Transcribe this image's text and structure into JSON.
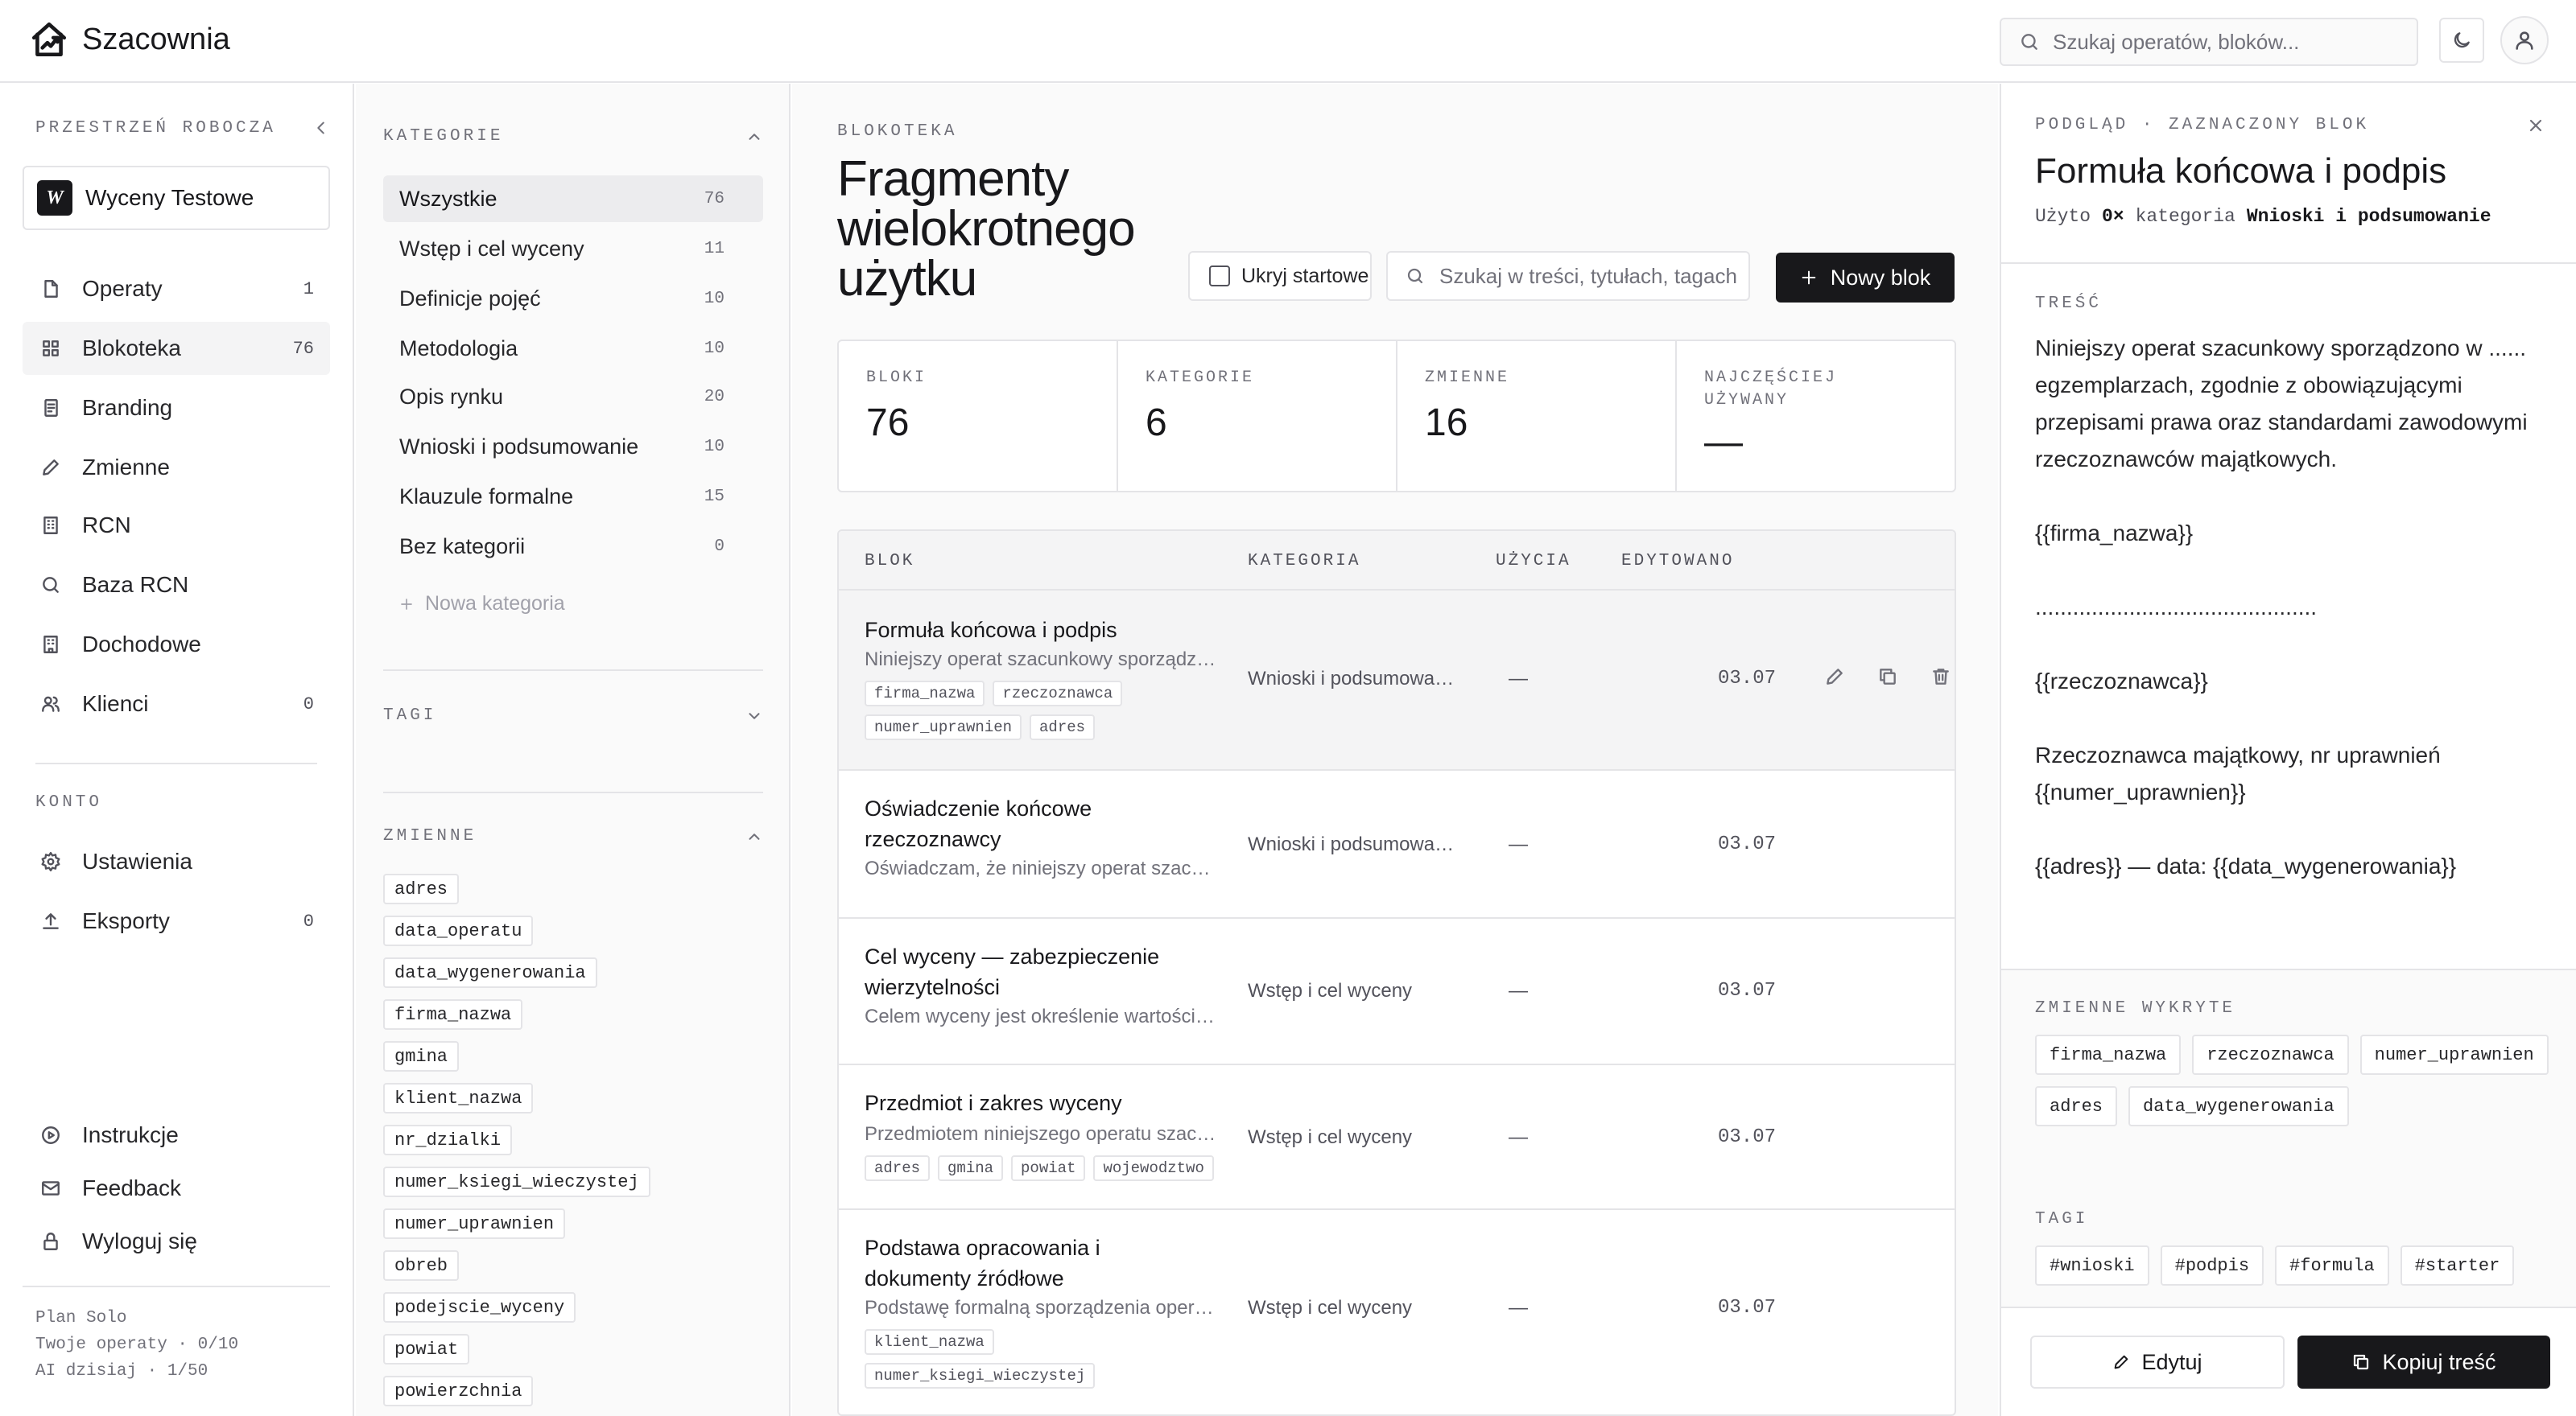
{
  "app": {
    "title": "Szacownia",
    "search_placeholder": "Szukaj operatów, bloków...",
    "icons": {
      "logo": "house-chart-logo",
      "theme": "moon-icon",
      "user": "user-icon"
    }
  },
  "sidebar": {
    "workspace_label": "PRZESTRZEŃ ROBOCZA",
    "workspace_badge": "W",
    "workspace_name": "Wyceny Testowe",
    "nav": [
      {
        "label": "Operaty",
        "count": "1",
        "icon": "file-icon"
      },
      {
        "label": "Blokoteka",
        "count": "76",
        "icon": "grid-icon",
        "active": true
      },
      {
        "label": "Branding",
        "count": "",
        "icon": "document-icon"
      },
      {
        "label": "Zmienne",
        "count": "",
        "icon": "pencil-icon"
      },
      {
        "label": "RCN",
        "count": "",
        "icon": "building-icon"
      },
      {
        "label": "Baza RCN",
        "count": "",
        "icon": "search-icon"
      },
      {
        "label": "Dochodowe",
        "count": "",
        "icon": "building-icon"
      },
      {
        "label": "Klienci",
        "count": "0",
        "icon": "users-icon"
      }
    ],
    "konto_label": "KONTO",
    "konto": [
      {
        "label": "Ustawienia",
        "count": "",
        "icon": "gear-icon"
      },
      {
        "label": "Eksporty",
        "count": "0",
        "icon": "upload-icon"
      }
    ],
    "bottom": [
      {
        "label": "Instrukcje",
        "icon": "play-circle-icon"
      },
      {
        "label": "Feedback",
        "icon": "message-icon"
      },
      {
        "label": "Wyloguj się",
        "icon": "lock-icon"
      }
    ],
    "plan": {
      "line1": "Plan Solo",
      "line2": "Twoje operaty · 0/10",
      "line3": "AI dzisiaj · 1/50"
    }
  },
  "categories": {
    "label": "KATEGORIE",
    "items": [
      {
        "label": "Wszystkie",
        "count": "76",
        "active": true
      },
      {
        "label": "Wstęp i cel wyceny",
        "count": "11"
      },
      {
        "label": "Definicje pojęć",
        "count": "10"
      },
      {
        "label": "Metodologia",
        "count": "10"
      },
      {
        "label": "Opis rynku",
        "count": "20"
      },
      {
        "label": "Wnioski i podsumowanie",
        "count": "10"
      },
      {
        "label": "Klauzule formalne",
        "count": "15"
      },
      {
        "label": "Bez kategorii",
        "count": "0"
      }
    ],
    "new_label": "Nowa kategoria",
    "tags_label": "TAGI",
    "vars_label": "ZMIENNE",
    "variables": [
      "adres",
      "data_operatu",
      "data_wygenerowania",
      "firma_nazwa",
      "gmina",
      "klient_nazwa",
      "nr_dzialki",
      "numer_ksiegi_wieczystej",
      "numer_uprawnien",
      "obreb",
      "podejscie_wyceny",
      "powiat",
      "powierzchnia"
    ]
  },
  "main": {
    "eyebrow": "BLOKOTEKA",
    "title": "Fragmenty wielokrotnego użytku",
    "checkbox_label": "Ukryj startowe",
    "search_placeholder": "Szukaj w treści, tytułach, tagach",
    "new_button": "Nowy blok",
    "stats": [
      {
        "label": "BLOKI",
        "value": "76"
      },
      {
        "label": "KATEGORIE",
        "value": "6"
      },
      {
        "label": "ZMIENNE",
        "value": "16"
      },
      {
        "label": "NAJCZĘŚCIEJ UŻYWANY",
        "value": "—"
      }
    ],
    "columns": {
      "blok": "BLOK",
      "kategoria": "KATEGORIA",
      "uzycia": "UŻYCIA",
      "edytowano": "EDYTOWANO"
    },
    "rows": [
      {
        "title": "Formuła końcowa i podpis",
        "subtitle": "Niniejszy operat szacunkowy sporządzono w",
        "tags": [
          "firma_nazwa",
          "rzeczoznawca",
          "numer_uprawnien",
          "adres"
        ],
        "category": "Wnioski i podsumowanie",
        "uses": "—",
        "edited": "03.07",
        "selected": true
      },
      {
        "title": "Oświadczenie końcowe rzeczoznawcy",
        "subtitle": "Oświadczam, że niniejszy operat szacunkowy",
        "tags": [],
        "category": "Wnioski i podsumowanie",
        "uses": "—",
        "edited": "03.07"
      },
      {
        "title": "Cel wyceny — zabezpieczenie wierzytelności",
        "subtitle": "Celem wyceny jest określenie wartości rynkowej",
        "tags": [],
        "category": "Wstęp i cel wyceny",
        "uses": "—",
        "edited": "03.07"
      },
      {
        "title": "Przedmiot i zakres wyceny",
        "subtitle": "Przedmiotem niniejszego operatu szacunkowego",
        "tags": [
          "adres",
          "gmina",
          "powiat",
          "wojewodztwo"
        ],
        "category": "Wstęp i cel wyceny",
        "uses": "—",
        "edited": "03.07"
      },
      {
        "title": "Podstawa opracowania i dokumenty źródłowe",
        "subtitle": "Podstawę formalną sporządzenia operatu",
        "tags": [
          "klient_nazwa",
          "numer_ksiegi_wieczystej"
        ],
        "category": "Wstęp i cel wyceny",
        "uses": "—",
        "edited": "03.07"
      }
    ]
  },
  "panel": {
    "eyebrow": "PODGLĄD · ZAZNACZONY BLOK",
    "title": "Formuła końcowa i podpis",
    "used_label": "Użyto",
    "used_value": "0×",
    "category_label": "kategoria",
    "category_value": "Wnioski i podsumowanie",
    "content_label": "TREŚĆ",
    "content": "Niniejszy operat szacunkowy sporządzono w ...... egzemplarzach, zgodnie z obowiązującymi przepisami prawa oraz standardami zawodowymi rzeczoznawców majątkowych.\n\n{{firma_nazwa}}\n\n.............................................\n\n{{rzeczoznawca}}\n\nRzeczoznawca majątkowy, nr uprawnień {{numer_uprawnien}}\n\n{{adres}} — data: {{data_wygenerowania}}",
    "vars_label": "ZMIENNE WYKRYTE",
    "vars": [
      "firma_nazwa",
      "rzeczoznawca",
      "numer_uprawnien",
      "adres",
      "data_wygenerowania"
    ],
    "tags_label": "TAGI",
    "tags": [
      "#wnioski",
      "#podpis",
      "#formula",
      "#starter"
    ],
    "edit_button": "Edytuj",
    "copy_button": "Kopiuj treść"
  }
}
